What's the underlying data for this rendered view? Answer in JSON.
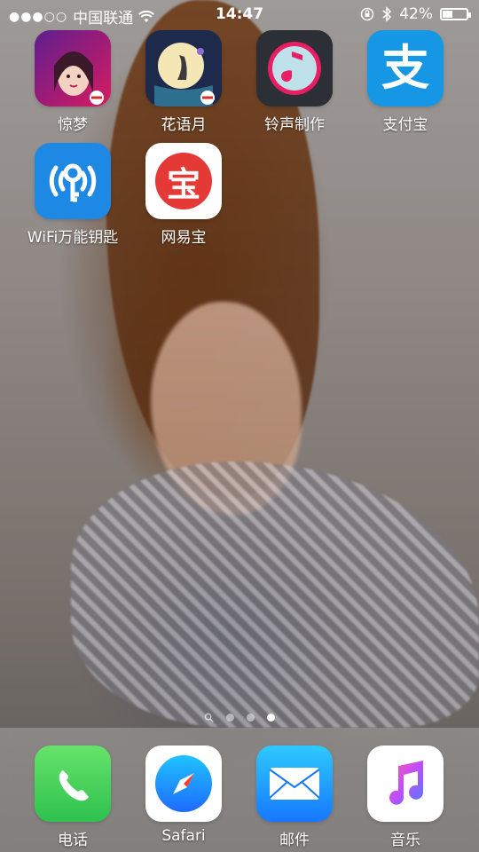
{
  "status_bar": {
    "carrier": "中国联通",
    "time": "14:47",
    "battery": "42%",
    "battery_level": 0.42
  },
  "apps": [
    {
      "label": "惊梦",
      "icon": "jingmeng-icon"
    },
    {
      "label": "花语月",
      "icon": "huayuyue-icon"
    },
    {
      "label": "铃声制作",
      "icon": "ringtone-icon"
    },
    {
      "label": "支付宝",
      "icon": "alipay-icon"
    },
    {
      "label": "WiFi万能钥匙",
      "icon": "wifi-key-icon"
    },
    {
      "label": "网易宝",
      "icon": "netease-bao-icon"
    }
  ],
  "dock": [
    {
      "label": "电话",
      "icon": "phone-icon"
    },
    {
      "label": "Safari",
      "icon": "safari-icon"
    },
    {
      "label": "邮件",
      "icon": "mail-icon"
    },
    {
      "label": "音乐",
      "icon": "music-icon"
    }
  ],
  "icon_text": {
    "alipay_glyph": "支",
    "netease_glyph": "宝"
  },
  "pages": {
    "count": 3,
    "active": 3
  }
}
